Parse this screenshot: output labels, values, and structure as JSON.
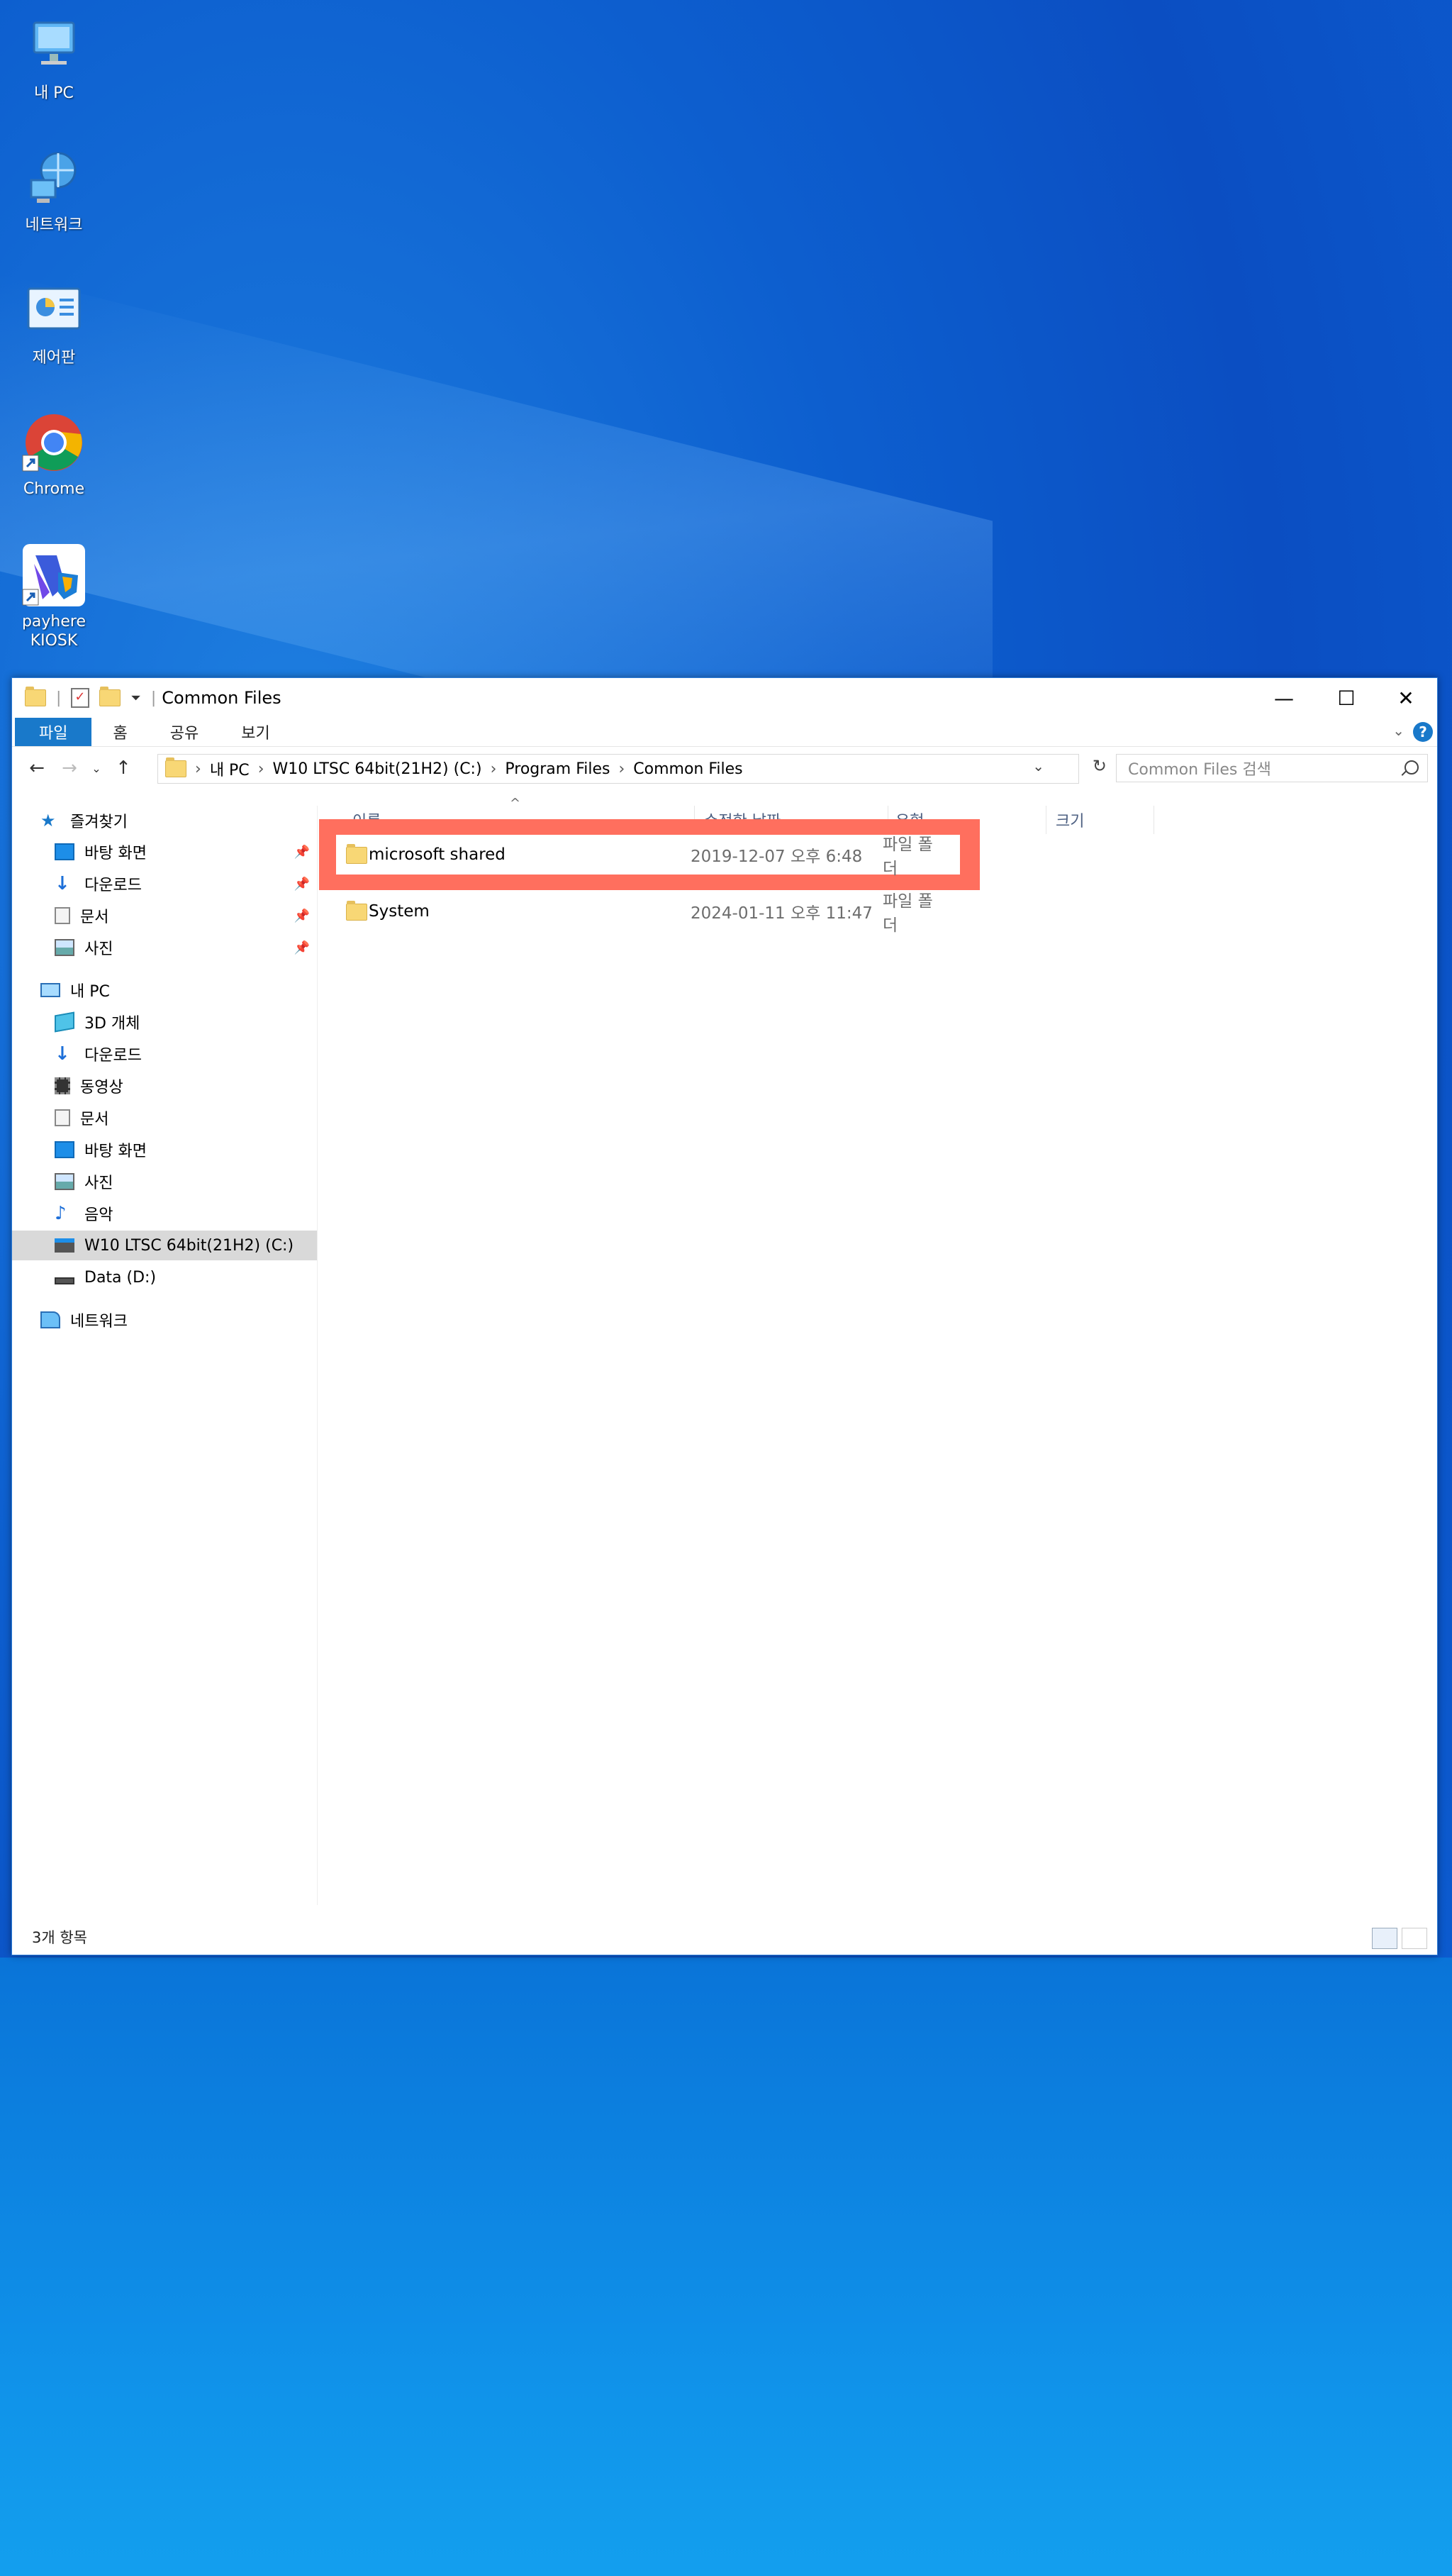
{
  "desktop": {
    "icons": [
      {
        "label": "내 PC",
        "icon": "computer-icon"
      },
      {
        "label": "네트워크",
        "icon": "network-icon"
      },
      {
        "label": "제어판",
        "icon": "control-panel-icon"
      },
      {
        "label": "Chrome",
        "icon": "chrome-icon"
      },
      {
        "label": "payhere KIOSK",
        "icon": "payhere-kiosk-icon"
      }
    ]
  },
  "window": {
    "title": "Common Files",
    "controls": {
      "minimize": "—",
      "maximize": "☐",
      "close": "✕"
    },
    "ribbon_tabs": [
      "파일",
      "홈",
      "공유",
      "보기"
    ],
    "help": "?"
  },
  "address": {
    "crumbs": [
      "내 PC",
      "W10 LTSC 64bit(21H2) (C:)",
      "Program Files",
      "Common Files"
    ],
    "search_placeholder": "Common Files 검색"
  },
  "nav": {
    "quick_access": {
      "label": "즐겨찾기",
      "items": [
        "바탕 화면",
        "다운로드",
        "문서",
        "사진"
      ]
    },
    "this_pc": {
      "label": "내 PC",
      "items": [
        "3D 개체",
        "다운로드",
        "동영상",
        "문서",
        "바탕 화면",
        "사진",
        "음악",
        "W10 LTSC 64bit(21H2) (C:)",
        "Data (D:)"
      ]
    },
    "network": "네트워크",
    "selected": "W10 LTSC 64bit(21H2) (C:)"
  },
  "columns": [
    "이름",
    "수정한 날짜",
    "유형",
    "크기"
  ],
  "files": [
    {
      "name": "microsoft shared",
      "date": "2019-12-07 오후 6:48",
      "type": "파일 폴더",
      "size": "",
      "highlighted": true
    },
    {
      "name": "System",
      "date": "2024-01-11 오후 11:47",
      "type": "파일 폴더",
      "size": "",
      "highlighted": false
    }
  ],
  "status": {
    "count": "3개 항목"
  },
  "colors": {
    "accent": "#1979ca",
    "highlight": "#ff6f5e",
    "folder": "#f8d775"
  }
}
